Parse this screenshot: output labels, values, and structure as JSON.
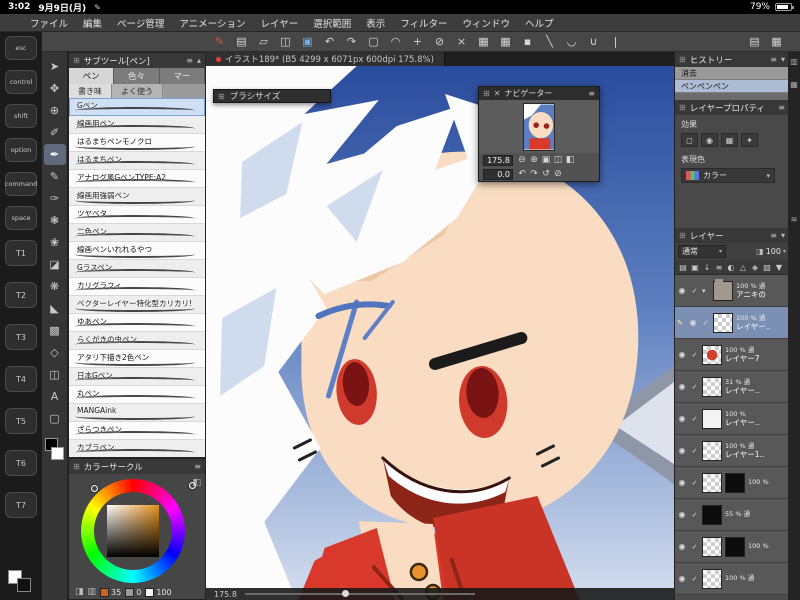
{
  "glyphs": {
    "grip": "⊞",
    "menu": "≡",
    "caret_down": "▾",
    "caret_up": "▴",
    "close": "✕",
    "eye": "◉",
    "check": "✓",
    "pencil": "✎"
  },
  "status_bar": {
    "time": "3:02",
    "date": "9月9日(月)",
    "battery_percent": "79%"
  },
  "menu_bar": {
    "items": [
      "ファイル",
      "編集",
      "ページ管理",
      "アニメーション",
      "レイヤー",
      "選択範囲",
      "表示",
      "フィルター",
      "ウィンドウ",
      "ヘルプ"
    ]
  },
  "toolbar": {
    "icons": [
      {
        "name": "clip-studio-logo-icon",
        "glyph": "✎",
        "color": "#e05040"
      },
      {
        "name": "new-file-icon",
        "glyph": "▤"
      },
      {
        "name": "open-file-icon",
        "glyph": "▱"
      },
      {
        "name": "save-icon",
        "glyph": "◫"
      },
      {
        "name": "export-image-icon",
        "glyph": "▣",
        "color": "#6fa8e8"
      },
      {
        "name": "undo-icon",
        "glyph": "↶"
      },
      {
        "name": "redo-icon",
        "glyph": "↷"
      },
      {
        "name": "select-rect-icon",
        "glyph": "▢"
      },
      {
        "name": "select-lasso-icon",
        "glyph": "◠"
      },
      {
        "name": "select-cross-icon",
        "glyph": "+"
      },
      {
        "name": "magic-wand-icon",
        "glyph": "⊘"
      },
      {
        "name": "deselect-icon",
        "glyph": "×"
      },
      {
        "name": "grid-view-icon",
        "glyph": "▦"
      },
      {
        "name": "grid-snap-icon",
        "glyph": "▦"
      },
      {
        "name": "swatch-icon",
        "glyph": "▪"
      },
      {
        "name": "line-tool-icon",
        "glyph": "╲"
      },
      {
        "name": "curve-tool-icon",
        "glyph": "◡"
      },
      {
        "name": "u-curve-tool-icon",
        "glyph": "∪"
      },
      {
        "name": "rule-tool-icon",
        "glyph": "|"
      }
    ],
    "right_icons": [
      {
        "name": "panel-layout-icon",
        "glyph": "▤"
      },
      {
        "name": "workspace-icon",
        "glyph": "▦"
      }
    ]
  },
  "document_tab": {
    "title": "イラスト189* (B5 4299 x 6071px 600dpi 175.8%)"
  },
  "edge_keys": {
    "items": [
      "esc",
      "control",
      "shift",
      "option",
      "command",
      "space",
      "T1",
      "T2",
      "T3",
      "T4",
      "T5",
      "T6",
      "T7"
    ],
    "fg_color": "#ffffff",
    "bg_color": "#111111"
  },
  "tool_strip": {
    "main_color": "#000000",
    "sub_color": "#ffffff",
    "icons": [
      {
        "name": "operation-tool-icon",
        "glyph": "➤"
      },
      {
        "name": "move-tool-icon",
        "glyph": "✥"
      },
      {
        "name": "zoom-tool-icon",
        "glyph": "⊕"
      },
      {
        "name": "eyedropper-tool-icon",
        "glyph": "✐"
      },
      {
        "name": "pen-tool-icon",
        "glyph": "✒",
        "selected": true
      },
      {
        "name": "pencil-tool-icon",
        "glyph": "✎"
      },
      {
        "name": "brush-tool-icon",
        "glyph": "✑"
      },
      {
        "name": "airbrush-tool-icon",
        "glyph": "❃"
      },
      {
        "name": "decoration-tool-icon",
        "glyph": "❀"
      },
      {
        "name": "eraser-tool-icon",
        "glyph": "◪"
      },
      {
        "name": "blend-tool-icon",
        "glyph": "❋"
      },
      {
        "name": "fill-tool-icon",
        "glyph": "◣"
      },
      {
        "name": "gradient-tool-icon",
        "glyph": "▩"
      },
      {
        "name": "shape-tool-icon",
        "glyph": "◇"
      },
      {
        "name": "frame-tool-icon",
        "glyph": "◫"
      },
      {
        "name": "text-tool-icon",
        "glyph": "A"
      },
      {
        "name": "selection-tool-icon",
        "glyph": "▢"
      }
    ]
  },
  "subtool_panel": {
    "title": "サブツール[ペン]",
    "tabs_row1": [
      {
        "label": "ペン",
        "selected": true
      },
      {
        "label": "色々"
      },
      {
        "label": "マー"
      }
    ],
    "tabs_row2": [
      {
        "label": "書き味",
        "selected": true
      },
      {
        "label": "よく使う"
      }
    ],
    "selected_brush_index": 0,
    "brushes": [
      "Gペン",
      "線画用ペン",
      "はるまちペンモノクロ",
      "はるまちペン",
      "アナログ風GペンTYPE:A2",
      "線画用強弱ペン",
      "ツヤベタ",
      "二色ペン",
      "線画ペンいれれるやつ",
      "Gラスペン",
      "カリグラフィ",
      "ベクターレイヤー特化型カリカリ!",
      "ゆあペン",
      "らくがきの虫ペン",
      "アタリ下描き2色ペン",
      "日本Gペン",
      "丸ペン",
      "MANGAink",
      "ざらつきペン",
      "カブラペン"
    ]
  },
  "color_panel": {
    "title": "カラーサークル",
    "mode_icons": [
      {
        "name": "color-wheel-mode-icon",
        "glyph": "◨"
      },
      {
        "name": "color-slider-mode-icon",
        "glyph": "▥"
      }
    ],
    "values": [
      {
        "name": "hue-value",
        "chip": "#c8641e",
        "value": "35"
      },
      {
        "name": "saturation-value",
        "chip": "#9a9a9a",
        "value": "0"
      },
      {
        "name": "brightness-value",
        "chip": "#f2f2f2",
        "value": "100"
      }
    ],
    "selected_color": "#e8921c"
  },
  "canvas": {
    "zoom_label": "175.8",
    "sky_top": "#2a4c9d",
    "sky_bottom": "#d4deef",
    "skin": "#f9dcc1",
    "cloth_red": "#d8392a"
  },
  "brush_size_panel": {
    "title": "ブラシサイズ"
  },
  "navigator": {
    "title": "ナビゲーター",
    "zoom_value": "175.8",
    "rotate_value": "0.0",
    "zoom_icons": [
      {
        "name": "zoom-out-icon",
        "glyph": "⊖"
      },
      {
        "name": "zoom-in-icon",
        "glyph": "⊕"
      },
      {
        "name": "fit-to-screen-icon",
        "glyph": "▣"
      },
      {
        "name": "actual-pixels-icon",
        "glyph": "◫"
      },
      {
        "name": "flip-horizontal-icon",
        "glyph": "◧"
      }
    ],
    "rotate_icons": [
      {
        "name": "rotate-left-icon",
        "glyph": "↶"
      },
      {
        "name": "rotate-right-icon",
        "glyph": "↷"
      },
      {
        "name": "reset-rotation-icon",
        "glyph": "↺"
      },
      {
        "name": "reset-display-icon",
        "glyph": "⊘"
      }
    ]
  },
  "history_panel": {
    "title": "ヒストリー",
    "items": [
      {
        "label": "消去"
      },
      {
        "label": "ペンペンペン",
        "selected": true
      }
    ]
  },
  "layer_property_panel": {
    "title": "レイヤープロパティ",
    "effect_label": "効果",
    "effect_icons": [
      {
        "name": "border-effect-icon",
        "glyph": "◻"
      },
      {
        "name": "tone-effect-icon",
        "glyph": "◉"
      },
      {
        "name": "layer-color-icon",
        "glyph": "▦"
      },
      {
        "name": "extract-line-icon",
        "glyph": "✦"
      }
    ],
    "expression_label": "表現色",
    "color_value": "カラー"
  },
  "layer_panel": {
    "title": "レイヤー",
    "blend_mode": "通常",
    "opacity_value": "100",
    "toolbar_icons": [
      {
        "name": "new-layer-icon",
        "glyph": "▤"
      },
      {
        "name": "new-folder-icon",
        "glyph": "▣"
      },
      {
        "name": "transfer-layer-icon",
        "glyph": "↓"
      },
      {
        "name": "combine-layer-icon",
        "glyph": "≡"
      },
      {
        "name": "mask-icon",
        "glyph": "◐"
      },
      {
        "name": "ruler-icon",
        "glyph": "△"
      },
      {
        "name": "lock-layer-icon",
        "glyph": "◈"
      },
      {
        "name": "lock-alpha-icon",
        "glyph": "▨"
      },
      {
        "name": "delete-layer-icon",
        "glyph": "▼"
      }
    ],
    "layers": [
      {
        "pct": "100 % 通",
        "name": "アニキの",
        "thumbs": [
          "folder"
        ],
        "folder": true
      },
      {
        "pct": "100 % 通",
        "name": "レイヤー..",
        "thumbs": [
          "checker"
        ],
        "selected": true,
        "editing": true
      },
      {
        "pct": "100 % 通",
        "name": "レイヤー7",
        "thumbs": [
          "red"
        ]
      },
      {
        "pct": "31 % 通",
        "name": "レイヤー..",
        "thumbs": [
          "checker"
        ]
      },
      {
        "pct": "100 %",
        "name": "レイヤー..",
        "thumbs": [
          "white"
        ]
      },
      {
        "pct": "100 % 通",
        "name": "レイヤー1..",
        "thumbs": [
          "checker"
        ]
      },
      {
        "pct": "100 %",
        "name": "",
        "thumbs": [
          "checker",
          "black"
        ]
      },
      {
        "pct": "55 % 通",
        "name": "",
        "thumbs": [
          "black"
        ]
      },
      {
        "pct": "100 %",
        "name": "",
        "thumbs": [
          "checker",
          "black"
        ]
      },
      {
        "pct": "100 % 通",
        "name": "",
        "thumbs": [
          "checker"
        ]
      }
    ]
  },
  "right_edge": {
    "icons": [
      {
        "name": "history-panel-tab-icon",
        "glyph": "▤",
        "gap": 0
      },
      {
        "name": "property-panel-tab-icon",
        "glyph": "▥",
        "gap": 8
      },
      {
        "name": "navigator-panel-tab-icon",
        "glyph": "▦",
        "gap": 8
      },
      {
        "name": "layer-panel-tab-icon",
        "glyph": "≋",
        "gap": 120
      }
    ]
  }
}
